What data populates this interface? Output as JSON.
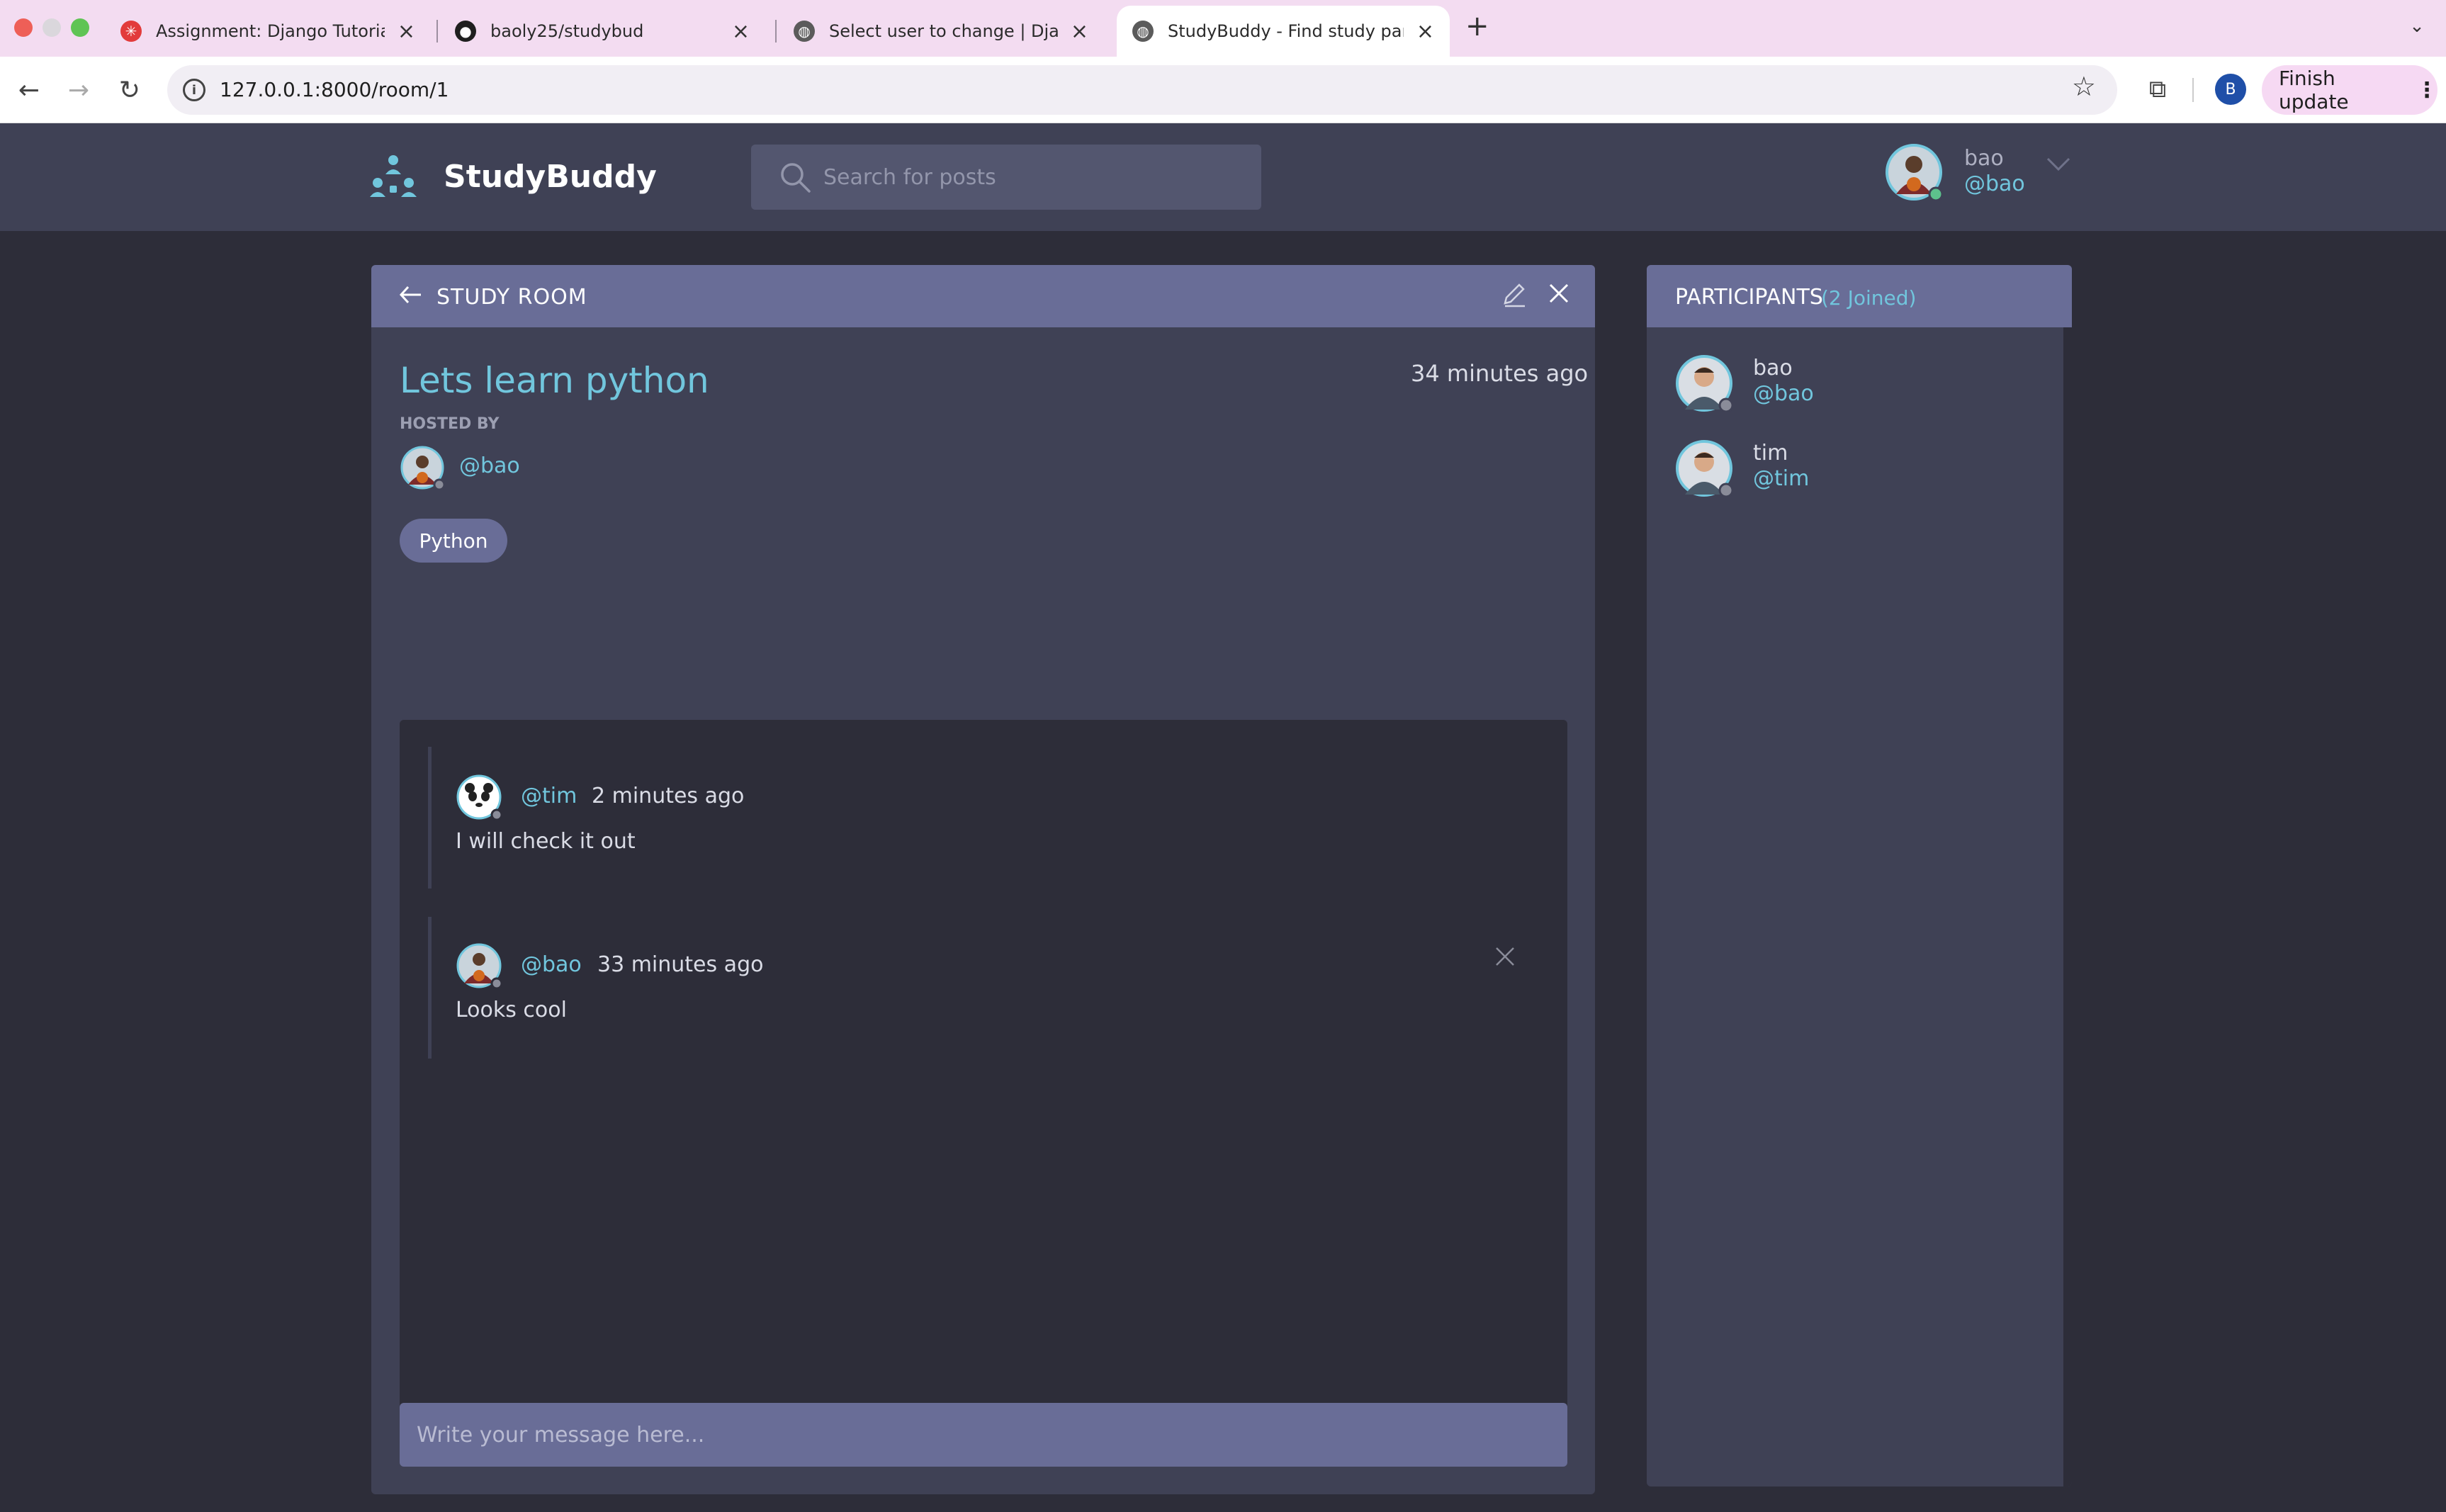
{
  "browser": {
    "tabs": [
      {
        "title": "Assignment: Django Tutorial p",
        "active": false
      },
      {
        "title": "baoly25/studybud",
        "active": false
      },
      {
        "title": "Select user to change | Djang",
        "active": false
      },
      {
        "title": "StudyBuddy - Find study part",
        "active": true
      }
    ],
    "url": "127.0.0.1:8000/room/1",
    "profile_initial": "B",
    "finish_update": "Finish update"
  },
  "header": {
    "brand": "StudyBuddy",
    "search_placeholder": "Search for posts",
    "user": {
      "name": "bao",
      "handle": "@bao"
    }
  },
  "room": {
    "header_label": "STUDY ROOM",
    "name": "Lets learn python",
    "created": "34 minutes ago",
    "hosted_by_label": "HOSTED BY",
    "host_handle": "@bao",
    "topic": "Python",
    "messages": [
      {
        "handle": "@tim",
        "time": "2 minutes ago",
        "body": "I will check it out",
        "deletable": false
      },
      {
        "handle": "@bao",
        "time": "33 minutes ago",
        "body": "Looks cool",
        "deletable": true
      }
    ],
    "composer_placeholder": "Write your message here..."
  },
  "participants": {
    "title": "PARTICIPANTS",
    "count_label": "(2 Joined)",
    "list": [
      {
        "name": "bao",
        "handle": "@bao"
      },
      {
        "name": "tim",
        "handle": "@tim"
      }
    ]
  },
  "colors": {
    "page_bg": "#2d2d39",
    "panel_bg": "#3f4155",
    "panel_header": "#696d97",
    "accent": "#71c6dd",
    "text": "#dadce6",
    "online": "#5dc18c",
    "offline": "#8a8c99"
  }
}
